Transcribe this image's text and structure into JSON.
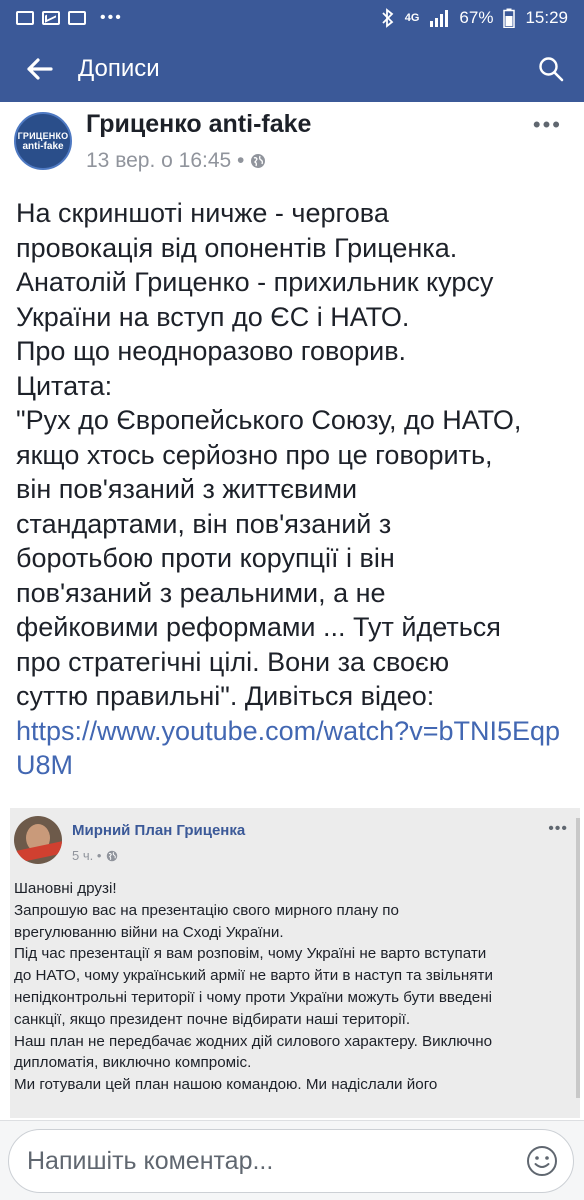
{
  "status_bar": {
    "network": "4G",
    "battery": "67%",
    "time": "15:29",
    "more": "•••"
  },
  "app_bar": {
    "title": "Дописи"
  },
  "post": {
    "page_name": "Гриценко anti-fake",
    "avatar_line1": "ГРИЦЕНКО",
    "avatar_line2": "anti-fake",
    "time": "13 вер. о 16:45 •",
    "more": "•••",
    "text": "На скриншоті ничже - чергова\nпровокація від опонентів Гриценка.\nАнатолій Гриценко - прихильник курсу\nУкраїни на вступ до ЄС і НАТО.\nПро що неодноразово говорив.\nЦитата:\n\"Рух до Європейського Союзу, до НАТО,\nякщо хтось серйозно про це говорить,\nвін пов'язаний з життєвими\nстандартами, він пов'язаний з\nборотьбою проти корупції і він\nпов'язаний з реальними, а не\nфейковими реформами ... Тут йдеться\nпро стратегічні цілі. Вони за своєю\nсуттю правильні\". Дивіться відео:",
    "link": "https://www.youtube.com/watch?v=bTNI5EqpU8M"
  },
  "screenshot": {
    "name": "Мирний План Гриценка",
    "time": "5 ч. •",
    "more": "•••",
    "text": "Шановні друзі!\nЗапрошую вас на презентацію свого мирного плану по\nврегулюванню війни на Сході України.\nПід час презентації я вам розповім, чому Україні не варто вступати\nдо НАТО, чому український армії не варто йти в наступ та звільняти\nнепідконтрольні території і чому проти України можуть бути введені\nсанкції, якщо президент почне відбирати наші території.\nНаш план не передбачає жодних дій силового характеру. Виключно\nдипломатія, виключно компроміс.\nМи готували цей план нашою командою. Ми надіслали його"
  },
  "comment": {
    "placeholder": "Напишіть коментар..."
  },
  "colors": {
    "brand": "#3b5998",
    "link": "#4267b2",
    "meta": "#90949c"
  },
  "icons": [
    "gallery-icon",
    "mail-icon",
    "bluetooth-icon",
    "signal-icon",
    "back-arrow-icon",
    "search-icon",
    "globe-icon",
    "emoji-icon"
  ]
}
